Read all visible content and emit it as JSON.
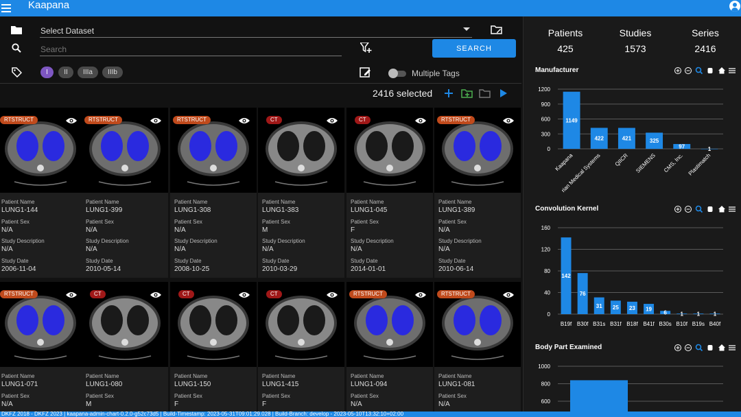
{
  "app": {
    "title": "Kaapana"
  },
  "filters": {
    "dataset_placeholder": "Select Dataset",
    "search_placeholder": "Search",
    "search_button": "SEARCH",
    "tags": [
      "I",
      "II",
      "IIIa",
      "IIIb"
    ],
    "multiple_tags_label": "Multiple Tags"
  },
  "selection": {
    "count_text": "2416 selected"
  },
  "field_labels": {
    "patient_name": "Patient Name",
    "patient_sex": "Patient Sex",
    "study_description": "Study Description",
    "study_date": "Study Date"
  },
  "cards": [
    {
      "modality": "RTSTRUCT",
      "patient_name": "LUNG1-144",
      "patient_sex": "N/A",
      "study_description": "N/A",
      "study_date": "2006-11-04"
    },
    {
      "modality": "RTSTRUCT",
      "patient_name": "LUNG1-399",
      "patient_sex": "N/A",
      "study_description": "N/A",
      "study_date": "2010-05-14"
    },
    {
      "modality": "RTSTRUCT",
      "patient_name": "LUNG1-308",
      "patient_sex": "N/A",
      "study_description": "N/A",
      "study_date": "2008-10-25"
    },
    {
      "modality": "CT",
      "patient_name": "LUNG1-383",
      "patient_sex": "M",
      "study_description": "N/A",
      "study_date": "2010-03-29"
    },
    {
      "modality": "CT",
      "patient_name": "LUNG1-045",
      "patient_sex": "F",
      "study_description": "N/A",
      "study_date": "2014-01-01"
    },
    {
      "modality": "RTSTRUCT",
      "patient_name": "LUNG1-389",
      "patient_sex": "N/A",
      "study_description": "N/A",
      "study_date": "2010-06-14"
    },
    {
      "modality": "RTSTRUCT",
      "patient_name": "LUNG1-071",
      "patient_sex": "N/A"
    },
    {
      "modality": "CT",
      "patient_name": "LUNG1-080",
      "patient_sex": "M"
    },
    {
      "modality": "CT",
      "patient_name": "LUNG1-150",
      "patient_sex": "F"
    },
    {
      "modality": "CT",
      "patient_name": "LUNG1-415",
      "patient_sex": "F"
    },
    {
      "modality": "RTSTRUCT",
      "patient_name": "LUNG1-094",
      "patient_sex": "N/A"
    },
    {
      "modality": "RTSTRUCT",
      "patient_name": "LUNG1-081",
      "patient_sex": "N/A"
    }
  ],
  "stats": [
    {
      "label": "Patients",
      "value": "425"
    },
    {
      "label": "Studies",
      "value": "1573"
    },
    {
      "label": "Series",
      "value": "2416"
    }
  ],
  "chart_data": [
    {
      "type": "bar",
      "title": "Manufacturer",
      "categories": [
        "Kaapana",
        "rian Medical Systems",
        "QIICR",
        "SIEMENS",
        "CMS, Inc.",
        "Plastimatch"
      ],
      "values": [
        1149,
        422,
        421,
        325,
        97,
        1
      ],
      "ylim": [
        0,
        1200
      ],
      "yticks": [
        0,
        300,
        600,
        900,
        1200
      ],
      "color": "#1e88e5"
    },
    {
      "type": "bar",
      "title": "Convolution Kernel",
      "categories": [
        "B19f",
        "B30f",
        "B31s",
        "B31f",
        "B18f",
        "B41f",
        "B30s",
        "B10f",
        "B19s",
        "B40f"
      ],
      "values": [
        142,
        76,
        31,
        25,
        23,
        19,
        6,
        1,
        1,
        1
      ],
      "ylim": [
        0,
        160
      ],
      "yticks": [
        0,
        40,
        80,
        120,
        160
      ],
      "color": "#1e88e5"
    },
    {
      "type": "bar",
      "title": "Body Part Examined",
      "categories": [
        ""
      ],
      "values": [
        840
      ],
      "ylim": [
        600,
        1000
      ],
      "yticks": [
        600,
        800,
        1000
      ],
      "color": "#1e88e5"
    }
  ],
  "status_text": "DKFZ 2018 - DKFZ 2023 | kaapana-admin-chart-0.2.0-g52c73d5 | Build-Timestamp: 2023-05-31T09:01:29.028 | Build-Branch: develop - 2023-05-10T13:32:10+02:00",
  "colors": {
    "accent": "#1e88e5",
    "badge_rtstruct": "#c04a1c",
    "badge_ct": "#a01818",
    "tag_primary": "#7e57c2",
    "lung_overlay": "#2a2adf"
  }
}
